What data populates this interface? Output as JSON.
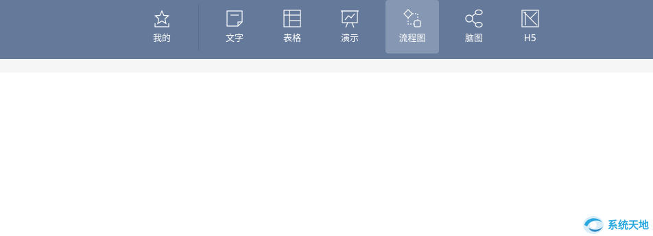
{
  "toolbar": {
    "items": [
      {
        "label": "我的",
        "icon": "star-icon"
      },
      {
        "label": "文字",
        "icon": "document-icon"
      },
      {
        "label": "表格",
        "icon": "table-icon"
      },
      {
        "label": "演示",
        "icon": "presentation-icon"
      },
      {
        "label": "流程图",
        "icon": "flowchart-icon",
        "active": true
      },
      {
        "label": "脑图",
        "icon": "mindmap-icon"
      },
      {
        "label": "H5",
        "icon": "h5-icon"
      }
    ]
  },
  "watermark": {
    "text": "系统天地",
    "icon": "logo-icon"
  },
  "colors": {
    "toolbar_bg": "#657a9b",
    "active_bg": "#8597b2",
    "subbar_bg": "#f6f6f7",
    "watermark": "#29a7df"
  }
}
